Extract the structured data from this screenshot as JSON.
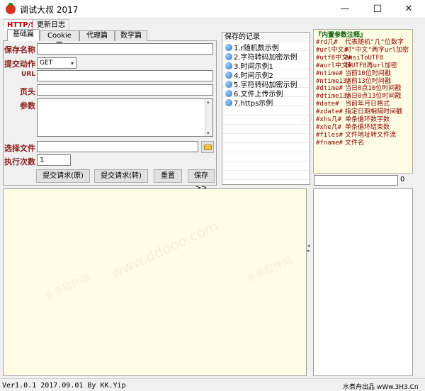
{
  "window": {
    "title": "调试大叔 2017",
    "minimize": "—",
    "maximize": "☐",
    "close": "✕"
  },
  "top_tabs": [
    "HTTP/S",
    "更新日志"
  ],
  "sub_tabs": [
    "基础篇",
    "Cookie篇",
    "代理篇",
    "数学篇"
  ],
  "form": {
    "save_name_label": "保存名称",
    "save_name_value": "",
    "method_label": "提交动作",
    "method_value": "GET",
    "url_label": "URL",
    "url_value": "",
    "header_label": "页头",
    "header_value": "",
    "params_label": "参数",
    "params_value": "",
    "file_label": "选择文件",
    "file_value": "",
    "count_label": "执行次数",
    "count_value": "1"
  },
  "buttons": {
    "submit_raw": "提交请求(原)",
    "submit_conv": "提交请求(转)",
    "reset": "重置",
    "save": "保存>>"
  },
  "saved_records": {
    "title": "保存的记录",
    "items": [
      "1.r随机数示例",
      "2.字符转码加密示例",
      "3.时间示例1",
      "4.时间示例2",
      "5.字符转码加密示例",
      "6.文件上传示例",
      "7.https示例"
    ]
  },
  "params_help": {
    "title": "内置参数注释",
    "lines": [
      {
        "k": "#rd几#",
        "v": "代表随机\"几\"位数字"
      },
      {
        "k": "#url中文#",
        "v": "对\"中文\"两字url加密"
      },
      {
        "k": "#utf8中文#",
        "v": "AnsiToUTF8"
      },
      {
        "k": "#aurl中文#",
        "v": "转UTF8再url加密"
      },
      {
        "k": "#ntime#",
        "v": "当前10位时间戳"
      },
      {
        "k": "#ntime13#",
        "v": "当前13位时间戳"
      },
      {
        "k": "#dtime#",
        "v": "当日0点10位时间戳"
      },
      {
        "k": "#dtime13#",
        "v": "当日0点13位时间戳"
      },
      {
        "k": "#date#",
        "v": "当前年月日格式"
      },
      {
        "k": "#zdate#",
        "v": "指定日期相隔时间戳"
      },
      {
        "k": "#xhs几#",
        "v": "单条循环数字数"
      },
      {
        "k": "#xhe几#",
        "v": "单条循环结束数"
      },
      {
        "k": "#files#",
        "v": "文件地址转文件流"
      },
      {
        "k": "#fname#",
        "v": "文件名"
      }
    ]
  },
  "counter": {
    "value": "",
    "label": "0"
  },
  "watermarks": [
    "多多软件站",
    "www.ddooo.com"
  ],
  "status": {
    "version": "Ver1.0.1 2017.09.01 By KK.Yip",
    "credit": "水煮舟出品 wWw.3H3.Cn"
  },
  "colors": {
    "label_red": "#8b1c1c",
    "cream": "#fdfde3",
    "active_tab_red": "#c00000"
  }
}
